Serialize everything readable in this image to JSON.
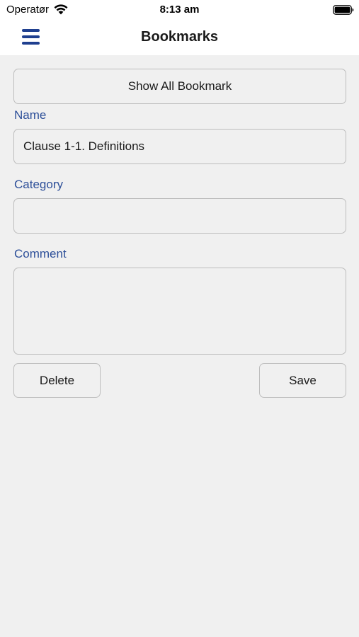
{
  "status_bar": {
    "carrier": "Operatør",
    "time": "8:13 am"
  },
  "nav": {
    "title": "Bookmarks",
    "menu_icon": "hamburger-menu-icon",
    "accent_color": "#1f3f8f"
  },
  "form": {
    "show_all_label": "Show All Bookmark",
    "name_label": "Name",
    "name_value": "Clause 1-1. Definitions",
    "category_label": "Category",
    "category_value": "",
    "comment_label": "Comment",
    "comment_value": "",
    "delete_label": "Delete",
    "save_label": "Save",
    "label_color": "#2d4f99"
  }
}
